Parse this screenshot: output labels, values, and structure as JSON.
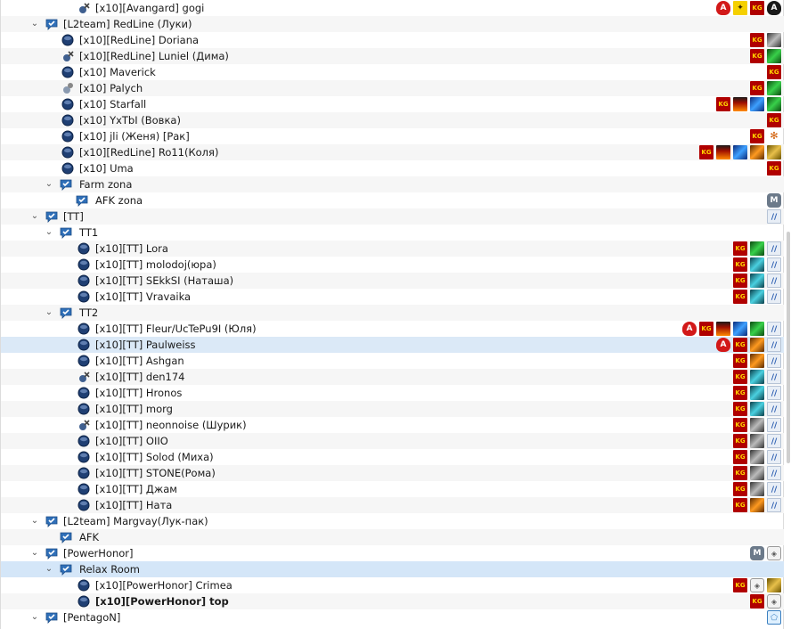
{
  "rows": [
    {
      "depth": 2,
      "type": "user",
      "status": "mute",
      "label": "[x10][Avangard] gogi",
      "badges": [
        "ang",
        "bee",
        "red",
        "ang2"
      ]
    },
    {
      "depth": 0,
      "type": "channel",
      "expander": "⌄",
      "label": "[L2team] RedLine (Луки)",
      "badges": []
    },
    {
      "depth": 1,
      "type": "user",
      "status": "online",
      "label": "[x10][RedLine] Doriana",
      "badges": [
        "red",
        "gray"
      ]
    },
    {
      "depth": 1,
      "type": "user",
      "status": "mute",
      "label": "[x10][RedLine] Luniel (Дима)",
      "badges": [
        "red",
        "green"
      ]
    },
    {
      "depth": 1,
      "type": "user",
      "status": "online",
      "label": "[x10] Maverick",
      "badges": [
        "red"
      ]
    },
    {
      "depth": 1,
      "type": "user",
      "status": "away",
      "label": "[x10] Palych",
      "badges": [
        "red",
        "green"
      ]
    },
    {
      "depth": 1,
      "type": "user",
      "status": "online",
      "label": "[x10] Starfall",
      "badges": [
        "red",
        "fire",
        "blue",
        "green"
      ]
    },
    {
      "depth": 1,
      "type": "user",
      "status": "online",
      "label": "[x10] YxTbI (Вовка)",
      "badges": [
        "red"
      ]
    },
    {
      "depth": 1,
      "type": "user",
      "status": "online",
      "label": "[x10] jli (Женя) [Рак]",
      "badges": [
        "red",
        "paw"
      ]
    },
    {
      "depth": 1,
      "type": "user",
      "status": "online",
      "label": "[x10][RedLine] Ro11(Коля)",
      "badges": [
        "red",
        "fire",
        "blue",
        "orange",
        "gold"
      ]
    },
    {
      "depth": 1,
      "type": "user",
      "status": "online",
      "label": "[x10] Uma",
      "badges": [
        "red"
      ]
    },
    {
      "depth": 1,
      "type": "channel",
      "expander": "⌄",
      "label": "Farm zona",
      "badges": []
    },
    {
      "depth": 2,
      "type": "channel",
      "expander": "",
      "label": "AFK zona",
      "badges": [
        "m"
      ]
    },
    {
      "depth": 0,
      "type": "channel",
      "expander": "⌄",
      "label": "[TT]",
      "badges": [
        "chat"
      ]
    },
    {
      "depth": 1,
      "type": "channel",
      "expander": "⌄",
      "label": "TT1",
      "badges": []
    },
    {
      "depth": 2,
      "type": "user",
      "status": "online",
      "label": "[x10][TT] Lora",
      "badges": [
        "red",
        "green",
        "chat"
      ]
    },
    {
      "depth": 2,
      "type": "user",
      "status": "online",
      "label": "[x10][TT] molodoj(юра)",
      "badges": [
        "red",
        "teal",
        "chat"
      ]
    },
    {
      "depth": 2,
      "type": "user",
      "status": "online",
      "label": "[x10][TT] SEkkSI (Наташа)",
      "badges": [
        "red",
        "teal",
        "chat"
      ]
    },
    {
      "depth": 2,
      "type": "user",
      "status": "online",
      "label": "[x10][TT] Vravaika",
      "badges": [
        "red",
        "teal",
        "chat"
      ]
    },
    {
      "depth": 1,
      "type": "channel",
      "expander": "⌄",
      "label": "TT2",
      "badges": []
    },
    {
      "depth": 2,
      "type": "user",
      "status": "online",
      "label": "[x10][TT] Fleur/UcTePu9I (Юля)",
      "badges": [
        "ang",
        "red",
        "fire",
        "blue",
        "green",
        "chat"
      ]
    },
    {
      "depth": 2,
      "type": "user",
      "status": "online",
      "label": "[x10][TT] Paulweiss",
      "badges": [
        "ang",
        "red",
        "orange",
        "chat"
      ],
      "selected": true
    },
    {
      "depth": 2,
      "type": "user",
      "status": "online",
      "label": "[x10][TT] Ashgan",
      "badges": [
        "red",
        "orange",
        "chat"
      ]
    },
    {
      "depth": 2,
      "type": "user",
      "status": "mute",
      "label": "[x10][TT] den174",
      "badges": [
        "red",
        "teal",
        "chat"
      ]
    },
    {
      "depth": 2,
      "type": "user",
      "status": "online",
      "label": "[x10][TT] Hronos",
      "badges": [
        "red",
        "teal",
        "chat"
      ]
    },
    {
      "depth": 2,
      "type": "user",
      "status": "online",
      "label": "[x10][TT] morg",
      "badges": [
        "red",
        "teal",
        "chat"
      ]
    },
    {
      "depth": 2,
      "type": "user",
      "status": "mute",
      "label": "[x10][TT] neonnoise (Шурик)",
      "badges": [
        "red",
        "gray",
        "chat"
      ]
    },
    {
      "depth": 2,
      "type": "user",
      "status": "online",
      "label": "[x10][TT] OIIO",
      "badges": [
        "red",
        "gray",
        "chat"
      ]
    },
    {
      "depth": 2,
      "type": "user",
      "status": "online",
      "label": "[x10][TT] Solod (Миха)",
      "badges": [
        "red",
        "gray",
        "chat"
      ]
    },
    {
      "depth": 2,
      "type": "user",
      "status": "online",
      "label": "[x10][TT] STONE(Рома)",
      "badges": [
        "red",
        "gray",
        "chat"
      ]
    },
    {
      "depth": 2,
      "type": "user",
      "status": "online",
      "label": "[x10][TT] Джам",
      "badges": [
        "red",
        "gray",
        "chat"
      ]
    },
    {
      "depth": 2,
      "type": "user",
      "status": "online",
      "label": "[x10][TT] Ната",
      "badges": [
        "red",
        "orange",
        "chat"
      ]
    },
    {
      "depth": 0,
      "type": "channel",
      "expander": "⌄",
      "label": "[L2team] Margvay(Лук-пак)",
      "badges": []
    },
    {
      "depth": 1,
      "type": "channel",
      "expander": "",
      "label": "AFK",
      "badges": []
    },
    {
      "depth": 0,
      "type": "channel",
      "expander": "⌄",
      "label": "[PowerHonor]",
      "badges": [
        "m",
        "shield"
      ]
    },
    {
      "depth": 1,
      "type": "channel",
      "expander": "⌄",
      "label": "Relax Room",
      "badges": [],
      "selected2": true
    },
    {
      "depth": 2,
      "type": "user",
      "status": "online",
      "label": "[x10][PowerHonor] Crimea",
      "badges": [
        "red",
        "shield",
        "gold"
      ]
    },
    {
      "depth": 2,
      "type": "user",
      "status": "online",
      "label": "[x10][PowerHonor] top",
      "badges": [
        "red",
        "shield"
      ],
      "bold": true
    },
    {
      "depth": 0,
      "type": "channel",
      "expander": "⌄",
      "label": "[PentagoN]",
      "badges": [
        "pent"
      ]
    }
  ]
}
